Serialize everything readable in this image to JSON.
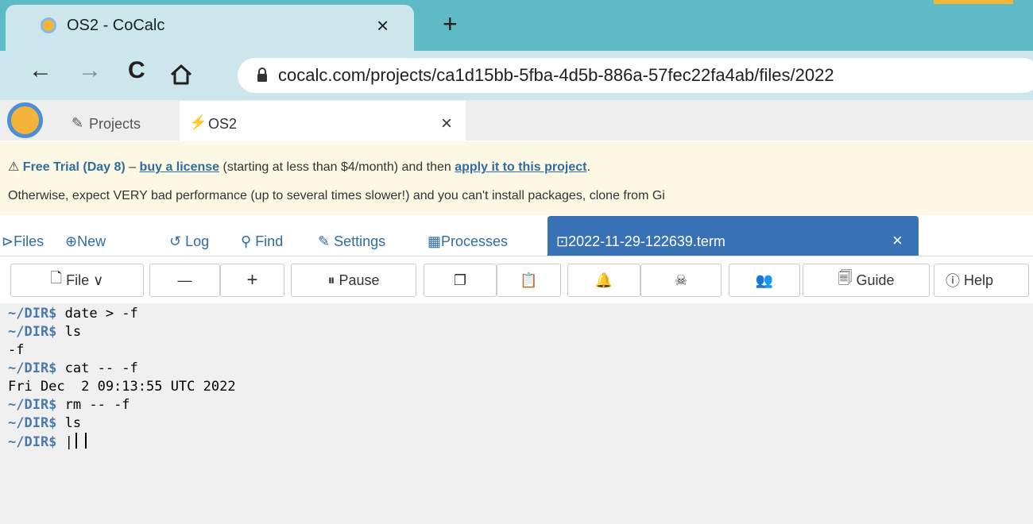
{
  "browser": {
    "tab_title": "OS2 - CoCalc",
    "url": "cocalc.com/projects/ca1d15bb-5fba-4d5b-886a-57fec22fa4ab/files/2022"
  },
  "cocalc_tabs": {
    "projects_label": "Projects",
    "project_label": "OS2"
  },
  "banner": {
    "trial": "Free Trial (Day 8)",
    "dash": " – ",
    "buy_link": "buy a license",
    "mid": " (starting at less than $4/month) and then ",
    "apply_link": "apply it to this project",
    "end": ".",
    "line2": "Otherwise, expect VERY bad performance (up to several times slower!) and you can't install packages, clone from Gi"
  },
  "project_nav": {
    "files": "Files",
    "new": "New",
    "log": "Log",
    "find": "Find",
    "settings": "Settings",
    "processes": "Processes",
    "open_file": "2022-11-29-122639.term"
  },
  "toolbar": {
    "file": "File",
    "minus": "—",
    "plus": "+",
    "pause": "Pause",
    "guide": "Guide",
    "help": "Help"
  },
  "terminal": {
    "prompt": "~/DIR$",
    "lines": [
      {
        "cmd": " date > -f"
      },
      {
        "cmd": " ls"
      },
      {
        "out": "-f"
      },
      {
        "cmd": " cat -- -f"
      },
      {
        "out": "Fri Dec  2 09:13:55 UTC 2022"
      },
      {
        "cmd": " rm -- -f"
      },
      {
        "cmd": " ls"
      },
      {
        "cmd": " |"
      }
    ]
  },
  "colors": {
    "browser_tabbar": "#5ebac4",
    "address_bar": "#cce6ec",
    "banner_bg": "#fcf8e3",
    "active_tab": "#3872b4",
    "link_blue": "#2e6da4",
    "terminal_bg": "#f0f0f0"
  },
  "icons": [
    "cocalc-logo-icon",
    "close-icon",
    "plus-icon",
    "back-icon",
    "forward-icon",
    "reload-icon",
    "home-icon",
    "lock-icon",
    "edit-icon",
    "rocket-icon",
    "warning-icon",
    "folder-icon",
    "plus-circle-icon",
    "history-icon",
    "search-icon",
    "wrench-icon",
    "cpu-icon",
    "terminal-icon",
    "file-icon",
    "chevron-down-icon",
    "pause-icon",
    "copy-icon",
    "paste-icon",
    "bell-icon",
    "skull-icon",
    "users-icon",
    "guide-icon",
    "help-icon"
  ]
}
